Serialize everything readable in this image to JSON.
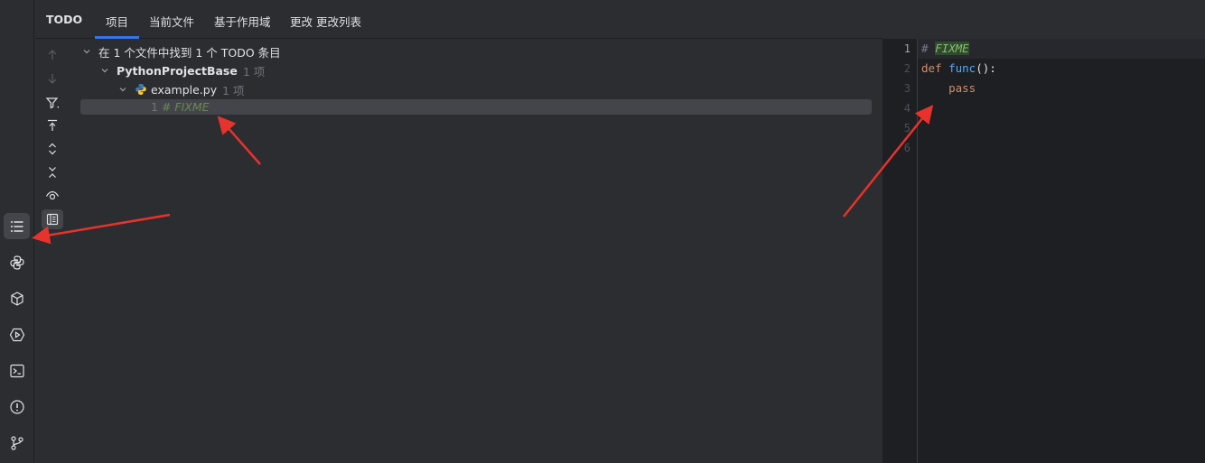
{
  "tool_window": {
    "title": "TODO",
    "tabs": [
      {
        "label": "项目",
        "selected": true
      },
      {
        "label": "当前文件",
        "selected": false
      },
      {
        "label": "基于作用域",
        "selected": false
      },
      {
        "label": "更改 更改列表",
        "selected": false
      }
    ]
  },
  "tree": {
    "summary": "在 1 个文件中找到 1 个 TODO 条目",
    "project": {
      "name": "PythonProjectBase",
      "count": "1 项"
    },
    "file": {
      "name": "example.py",
      "count": "1 项"
    },
    "item": {
      "line": "1",
      "text": "# FIXME"
    }
  },
  "toolbar_icons": [
    "arrow-up-icon",
    "arrow-down-icon",
    "filter-icon",
    "autoscroll-icon",
    "expand-all-icon",
    "collapse-all-icon",
    "preview-icon",
    "group-by-icon"
  ],
  "sidebar_icons": [
    "todo-list-icon",
    "python-packages-icon",
    "services-icon",
    "run-icon",
    "terminal-icon",
    "problems-icon",
    "git-icon"
  ],
  "editor": {
    "line_numbers": [
      "1",
      "2",
      "3",
      "4",
      "5",
      "6"
    ],
    "code": {
      "line1_hash": "# ",
      "line1_fixme": "FIXME",
      "line2_def": "def",
      "line2_func": "func",
      "line2_rest": "():",
      "line3_pass": "pass"
    }
  },
  "colors": {
    "accent": "#3574f0",
    "annotation_arrow": "#e8322c"
  }
}
